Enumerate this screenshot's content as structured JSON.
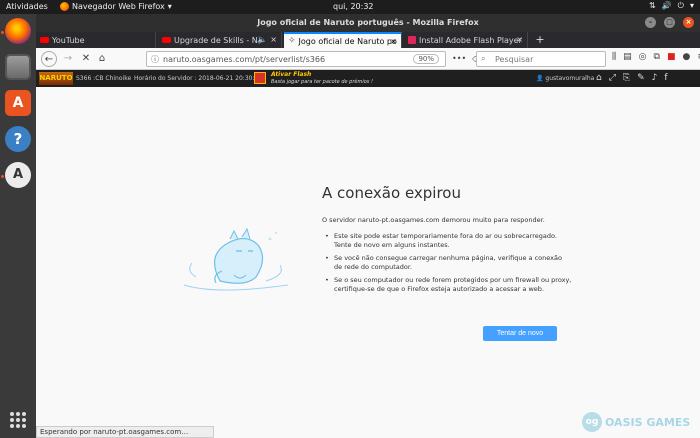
{
  "topbar": {
    "activities": "Atividades",
    "app_name": "Navegador Web Firefox",
    "clock": "qui, 20:32"
  },
  "window": {
    "title": "Jogo oficial de Naruto português - Mozilla Firefox"
  },
  "tabs": [
    {
      "label": "YouTube",
      "icon": "youtube-icon"
    },
    {
      "label": "Upgrade de Skills - N",
      "icon": "youtube-icon"
    },
    {
      "label": "Jogo oficial de Naruto po",
      "icon": "naruto-icon"
    },
    {
      "label": "Install Adobe Flash Player",
      "icon": "flash-icon"
    }
  ],
  "nav": {
    "url": "naruto.oasgames.com/pt/serverlist/s366",
    "zoom": "90%",
    "search_placeholder": "Pesquisar"
  },
  "game_header": {
    "logo": "NARUTO",
    "server": "S366 :CB Chinoike",
    "server_time": "Horário do Servidor : 2018-06-21 20:30:51",
    "flash_title": "Ativar Flash",
    "flash_sub": "Basta jogar para ter pacote de prêmios !",
    "username": "gustavomuralha"
  },
  "error": {
    "title": "A conexão expirou",
    "description": "O servidor naruto-pt.oasgames.com demorou muito para responder.",
    "bullets": [
      "Este site pode estar temporariamente fora do ar ou sobrecarregado. Tente de novo em alguns instantes.",
      "Se você não consegue carregar nenhuma página, verifique a conexão de rede do computador.",
      "Se o seu computador ou rede forem protegidos por um firewall ou proxy, certifique-se de que o Firefox esteja autorizado a acessar a web."
    ],
    "retry_label": "Tentar de novo"
  },
  "brand": {
    "badge": "og",
    "name": "OASIS GAMES"
  },
  "status": "Esperando por naruto-pt.oasgames.com…",
  "colors": {
    "accent": "#0a84ff",
    "retry": "#45a1ff",
    "ubuntu_orange": "#e95420"
  }
}
